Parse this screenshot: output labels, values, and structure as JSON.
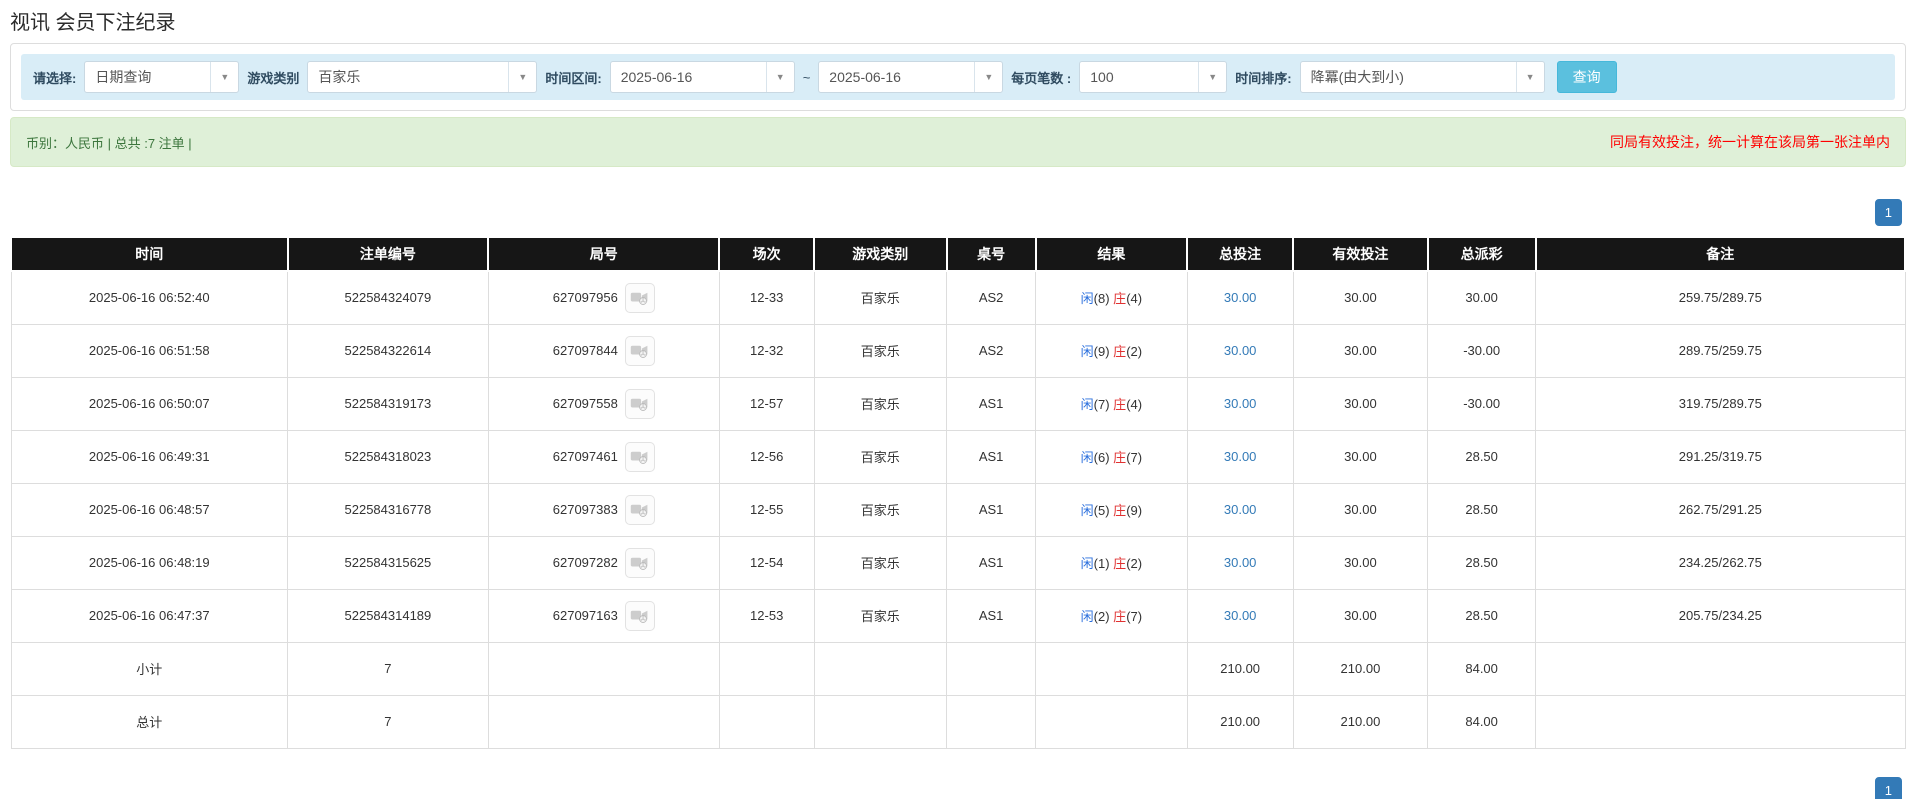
{
  "page": {
    "title": "视讯 会员下注纪录"
  },
  "filters": {
    "select_label": "请选择:",
    "query_type_value": "日期查询",
    "game_label": "游戏类别",
    "game_value": "百家乐",
    "range_label": "时间区间:",
    "date_from": "2025-06-16",
    "tilde": "~",
    "date_to": "2025-06-16",
    "per_page_label": "每页笔数 :",
    "per_page_value": "100",
    "sort_label": "时间排序:",
    "sort_value": "降冪(由大到小)",
    "search_button": "查询",
    "caret_icon": "▼"
  },
  "summary_bar": {
    "left": "币别：人民币 | 总共 :7 注单 |",
    "right": "同局有效投注，统一计算在该局第一张注单内"
  },
  "pagination": {
    "page": "1"
  },
  "table": {
    "headers": [
      "时间",
      "注单编号",
      "局号",
      "场次",
      "游戏类别",
      "桌号",
      "结果",
      "总投注",
      "有效投注",
      "总派彩",
      "备注"
    ],
    "col_widths": [
      "14.6%",
      "10.6%",
      "12.2%",
      "5.0%",
      "7.0%",
      "4.7%",
      "8.0%",
      "5.6%",
      "7.1%",
      "5.7%",
      "19.5%"
    ],
    "rows": [
      {
        "time": "2025-06-16 06:52:40",
        "bet_id": "522584324079",
        "round_id": "627097956",
        "session": "12-33",
        "game": "百家乐",
        "table": "AS2",
        "player": "闲",
        "player_pts": "(8)",
        "banker": "庄",
        "banker_pts": "(4)",
        "total_bet": "30.00",
        "valid_bet": "30.00",
        "payout": "30.00",
        "note": "259.75/289.75",
        "highlighted": false
      },
      {
        "time": "2025-06-16 06:51:58",
        "bet_id": "522584322614",
        "round_id": "627097844",
        "session": "12-32",
        "game": "百家乐",
        "table": "AS2",
        "player": "闲",
        "player_pts": "(9)",
        "banker": "庄",
        "banker_pts": "(2)",
        "total_bet": "30.00",
        "valid_bet": "30.00",
        "payout": "-30.00",
        "note": "289.75/259.75",
        "highlighted": false
      },
      {
        "time": "2025-06-16 06:50:07",
        "bet_id": "522584319173",
        "round_id": "627097558",
        "session": "12-57",
        "game": "百家乐",
        "table": "AS1",
        "player": "闲",
        "player_pts": "(7)",
        "banker": "庄",
        "banker_pts": "(4)",
        "total_bet": "30.00",
        "valid_bet": "30.00",
        "payout": "-30.00",
        "note": "319.75/289.75",
        "highlighted": true
      },
      {
        "time": "2025-06-16 06:49:31",
        "bet_id": "522584318023",
        "round_id": "627097461",
        "session": "12-56",
        "game": "百家乐",
        "table": "AS1",
        "player": "闲",
        "player_pts": "(6)",
        "banker": "庄",
        "banker_pts": "(7)",
        "total_bet": "30.00",
        "valid_bet": "30.00",
        "payout": "28.50",
        "note": "291.25/319.75",
        "highlighted": false
      },
      {
        "time": "2025-06-16 06:48:57",
        "bet_id": "522584316778",
        "round_id": "627097383",
        "session": "12-55",
        "game": "百家乐",
        "table": "AS1",
        "player": "闲",
        "player_pts": "(5)",
        "banker": "庄",
        "banker_pts": "(9)",
        "total_bet": "30.00",
        "valid_bet": "30.00",
        "payout": "28.50",
        "note": "262.75/291.25",
        "highlighted": false
      },
      {
        "time": "2025-06-16 06:48:19",
        "bet_id": "522584315625",
        "round_id": "627097282",
        "session": "12-54",
        "game": "百家乐",
        "table": "AS1",
        "player": "闲",
        "player_pts": "(1)",
        "banker": "庄",
        "banker_pts": "(2)",
        "total_bet": "30.00",
        "valid_bet": "30.00",
        "payout": "28.50",
        "note": "234.25/262.75",
        "highlighted": false
      },
      {
        "time": "2025-06-16 06:47:37",
        "bet_id": "522584314189",
        "round_id": "627097163",
        "session": "12-53",
        "game": "百家乐",
        "table": "AS1",
        "player": "闲",
        "player_pts": "(2)",
        "banker": "庄",
        "banker_pts": "(7)",
        "total_bet": "30.00",
        "valid_bet": "30.00",
        "payout": "28.50",
        "note": "205.75/234.25",
        "highlighted": false
      }
    ],
    "subtotal": {
      "label": "小计",
      "count": "7",
      "total_bet": "210.00",
      "valid_bet": "210.00",
      "payout": "84.00"
    },
    "total": {
      "label": "总计",
      "count": "7",
      "total_bet": "210.00",
      "valid_bet": "210.00",
      "payout": "84.00"
    }
  },
  "colors": {
    "header_bg": "#161616",
    "highlight_row": "#f8f69e",
    "summary_bg": "#9a9a9a",
    "link_blue": "#337ab7",
    "player_blue": "#2a6fdd",
    "banker_red": "#e03131",
    "negative_red": "#ff0000",
    "filter_bar_bg": "#d9edf7",
    "alert_bg": "#dff0d8",
    "search_btn": "#5bc0de",
    "pager_btn": "#337ab7"
  }
}
